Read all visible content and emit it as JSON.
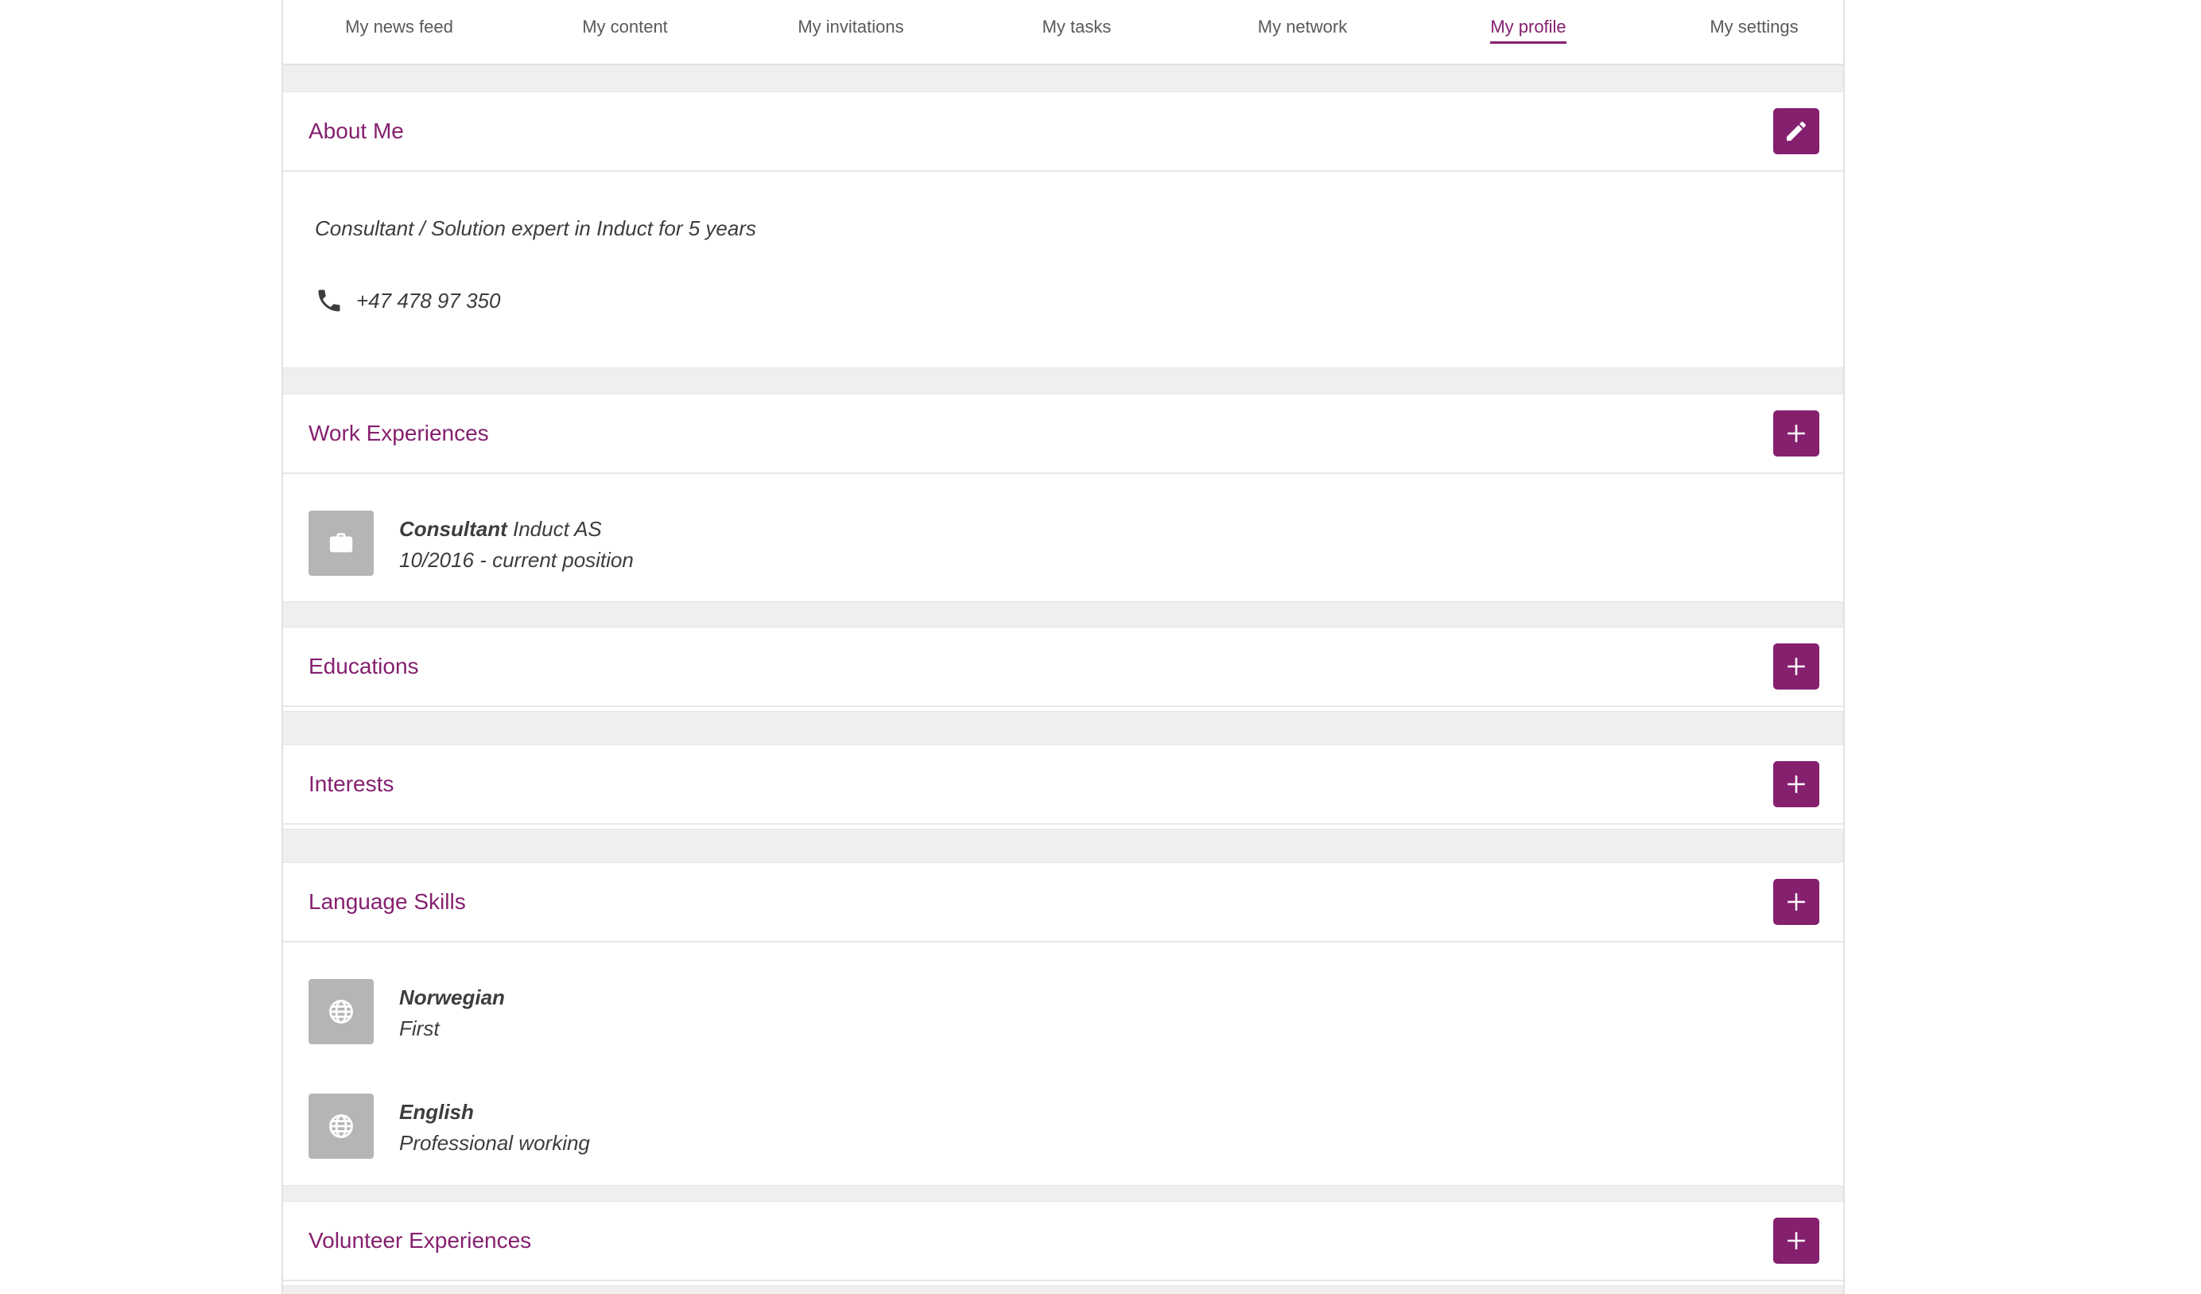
{
  "tabs": [
    {
      "label": "My news feed",
      "active": false
    },
    {
      "label": "My content",
      "active": false
    },
    {
      "label": "My invitations",
      "active": false
    },
    {
      "label": "My tasks",
      "active": false
    },
    {
      "label": "My network",
      "active": false
    },
    {
      "label": "My profile",
      "active": true
    },
    {
      "label": "My settings",
      "active": false
    }
  ],
  "about": {
    "title": "About Me",
    "description": "Consultant / Solution expert in Induct for 5 years",
    "phone": "+47 478 97 350"
  },
  "work": {
    "title": "Work Experiences",
    "items": [
      {
        "role": "Consultant",
        "company": "Induct AS",
        "period": "10/2016 - current position"
      }
    ]
  },
  "educations": {
    "title": "Educations"
  },
  "interests": {
    "title": "Interests"
  },
  "languages": {
    "title": "Language Skills",
    "items": [
      {
        "language": "Norwegian",
        "level": "First"
      },
      {
        "language": "English",
        "level": "Professional working"
      }
    ]
  },
  "volunteer": {
    "title": "Volunteer Experiences"
  },
  "colors": {
    "accent": "#85206f",
    "background": "#efefef",
    "icon_bg": "#b5b5b5"
  },
  "icons": {
    "edit": "pencil-icon",
    "add": "plus-icon",
    "phone": "phone-icon",
    "work": "briefcase-icon",
    "language": "globe-icon"
  }
}
